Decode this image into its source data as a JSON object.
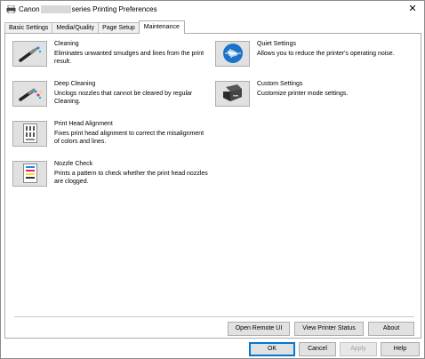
{
  "window": {
    "title_prefix": "Canon",
    "title_suffix": "series Printing Preferences",
    "close_glyph": "✕"
  },
  "tabs": [
    {
      "label": "Basic Settings",
      "active": false
    },
    {
      "label": "Media/Quality",
      "active": false
    },
    {
      "label": "Page Setup",
      "active": false
    },
    {
      "label": "Maintenance",
      "active": true
    }
  ],
  "functions": {
    "cleaning": {
      "title": "Cleaning",
      "desc": "Eliminates unwanted smudges and lines from the print result.",
      "icon": "cleaning-brush-icon"
    },
    "deep_cleaning": {
      "title": "Deep Cleaning",
      "desc": "Unclogs nozzles that cannot be cleared by regular Cleaning.",
      "icon": "deep-cleaning-brush-icon"
    },
    "print_head_alignment": {
      "title": "Print Head Alignment",
      "desc": "Fixes print head alignment to correct the misalignment of colors and lines.",
      "icon": "alignment-pattern-icon"
    },
    "nozzle_check": {
      "title": "Nozzle Check",
      "desc": "Prints a pattern to check whether the print head nozzles are clogged.",
      "icon": "nozzle-pattern-icon"
    },
    "quiet_settings": {
      "title": "Quiet Settings",
      "desc": "Allows you to reduce the printer's operating noise.",
      "icon": "quiet-wave-icon"
    },
    "custom_settings": {
      "title": "Custom Settings",
      "desc": "Customize printer mode settings.",
      "icon": "printer-icon"
    }
  },
  "panel_buttons": {
    "open_remote_ui": "Open Remote UI",
    "view_printer_status": "View Printer Status",
    "about": "About"
  },
  "dialog_buttons": {
    "ok": "OK",
    "cancel": "Cancel",
    "apply": "Apply",
    "help": "Help"
  },
  "colors": {
    "quiet_icon_blue": "#1a73c9",
    "ok_focus_border": "#0078d7"
  }
}
